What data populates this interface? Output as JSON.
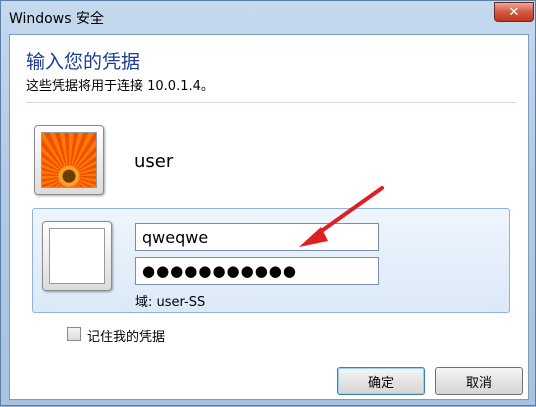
{
  "window": {
    "title": "Windows 安全",
    "close_symbol": "✕"
  },
  "dialog": {
    "heading": "输入您的凭据",
    "subheading": "这些凭据将用于连接 10.0.1.4。"
  },
  "credentials": [
    {
      "username": "user",
      "icon": "flower-avatar-icon"
    }
  ],
  "login": {
    "username_value": "qweqwe",
    "password_value": "●●●●●●●●●●●",
    "domain_label": "域: user-SS",
    "icon": "blank-avatar-icon"
  },
  "remember": {
    "label": "记住我的凭据",
    "checked": false
  },
  "buttons": {
    "ok": "确定",
    "cancel": "取消"
  },
  "annotation": {
    "arrow_color": "#e02020"
  }
}
